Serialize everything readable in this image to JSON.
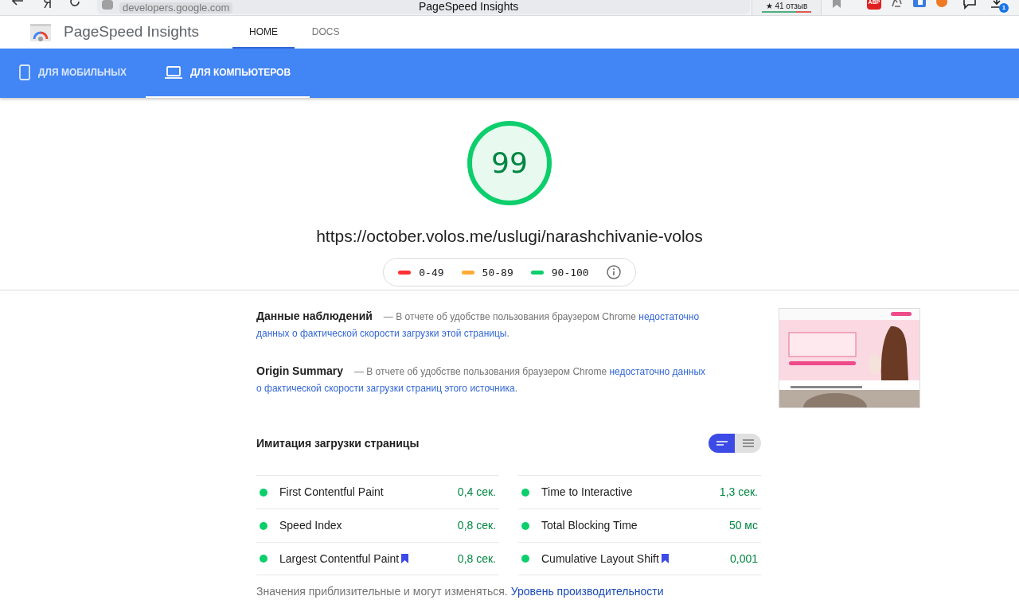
{
  "browser": {
    "address": "developers.google.com",
    "title": "PageSpeed Insights",
    "reviews": "★ 41 отзыв",
    "adblock": "ABP",
    "downloads": "1"
  },
  "header": {
    "product": "PageSpeed Insights",
    "nav": [
      {
        "label": "HOME",
        "selected": true
      },
      {
        "label": "DOCS",
        "selected": false
      }
    ]
  },
  "device_tabs": [
    {
      "label": "ДЛЯ МОБИЛЬНЫХ",
      "kind": "mobile",
      "selected": false
    },
    {
      "label": "ДЛЯ КОМПЬЮТЕРОВ",
      "kind": "desktop",
      "selected": true
    }
  ],
  "score": {
    "value": "99"
  },
  "url": "https://october.volos.me/uslugi/narashchivanie-volos",
  "legend": [
    {
      "range": "0-49",
      "color": "#ff3333"
    },
    {
      "range": "50-89",
      "color": "#ffaa33"
    },
    {
      "range": "90-100",
      "color": "#0cce6b"
    }
  ],
  "field_data": [
    {
      "title": "Данные наблюдений",
      "text": "— В отчете об удобстве пользования браузером Chrome",
      "link_lines": [
        "недостаточно",
        "данных о фактической скорости загрузки этой страницы"
      ],
      "end": "."
    },
    {
      "title": "Origin Summary",
      "text": "— В отчете об удобстве пользования браузером Chrome",
      "link_lines": [
        "недостаточно данных",
        "о фактической скорости загрузки страниц этого источника"
      ],
      "end": "."
    }
  ],
  "lab": {
    "title": "Имитация загрузки страницы",
    "view_toggle": [
      {
        "selected": true
      },
      {
        "selected": false
      }
    ],
    "metrics": [
      {
        "name": "First Contentful Paint",
        "value": "0,4 сек.",
        "color": "#0cce6b",
        "flagged": false
      },
      {
        "name": "Time to Interactive",
        "value": "1,3 сек.",
        "color": "#0cce6b",
        "flagged": false
      },
      {
        "name": "Speed Index",
        "value": "0,8 сек.",
        "color": "#0cce6b",
        "flagged": false
      },
      {
        "name": "Total Blocking Time",
        "value": "50 мс",
        "color": "#0cce6b",
        "flagged": false
      },
      {
        "name": "Largest Contentful Paint",
        "value": "0,8 сек.",
        "color": "#0cce6b",
        "flagged": true
      },
      {
        "name": "Cumulative Layout Shift",
        "value": "0,001",
        "color": "#0cce6b",
        "flagged": true
      }
    ],
    "note": "Значения приблизительные и могут изменяться.",
    "note_link": "Уровень производительности"
  }
}
